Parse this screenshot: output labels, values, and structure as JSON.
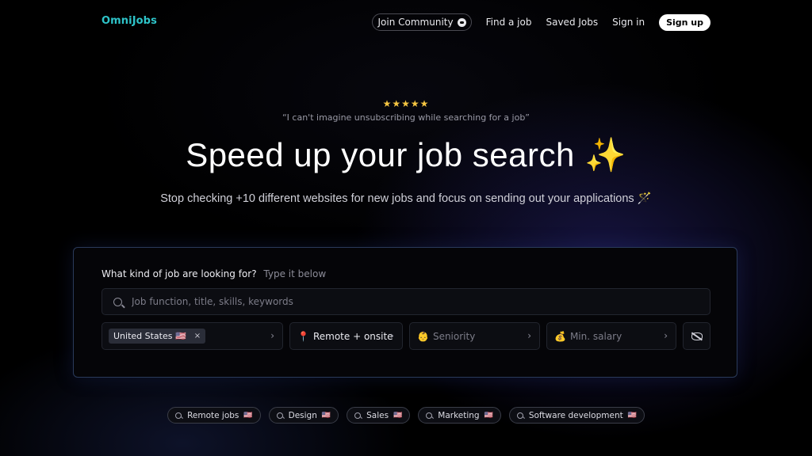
{
  "nav": {
    "logo": "OmniJobs",
    "community": "Join Community",
    "find_job": "Find a job",
    "saved_jobs": "Saved Jobs",
    "sign_in": "Sign in",
    "sign_up": "Sign up"
  },
  "hero": {
    "stars": "★★★★★",
    "rating": 5,
    "quote": "“I can't imagine unsubscribing while searching for a job”",
    "headline": "Speed up your job search",
    "headline_emoji": "✨",
    "subline": "Stop checking +10 different websites for new jobs and focus on sending out your applications 🪄"
  },
  "search": {
    "label": "What kind of job are looking for?",
    "hint": "Type it below",
    "placeholder": "Job function, title, skills, keywords",
    "value": ""
  },
  "filters": {
    "country_chip": "United States 🇺🇸",
    "chip_remove": "×",
    "remote_emoji": "📍",
    "remote": "Remote + onsite",
    "seniority_emoji": "👶",
    "seniority": "Seniority",
    "salary_emoji": "💰",
    "salary": "Min. salary",
    "chevron": "›"
  },
  "suggestions": [
    {
      "label": "Remote jobs",
      "flag": "🇺🇸"
    },
    {
      "label": "Design",
      "flag": "🇺🇸"
    },
    {
      "label": "Sales",
      "flag": "🇺🇸"
    },
    {
      "label": "Marketing",
      "flag": "🇺🇸"
    },
    {
      "label": "Software development",
      "flag": "🇺🇸"
    }
  ],
  "colors": {
    "brand": "#2ec4c9",
    "stars": "#f5c542",
    "background": "#000000",
    "card_border": "#2a3a5a"
  }
}
